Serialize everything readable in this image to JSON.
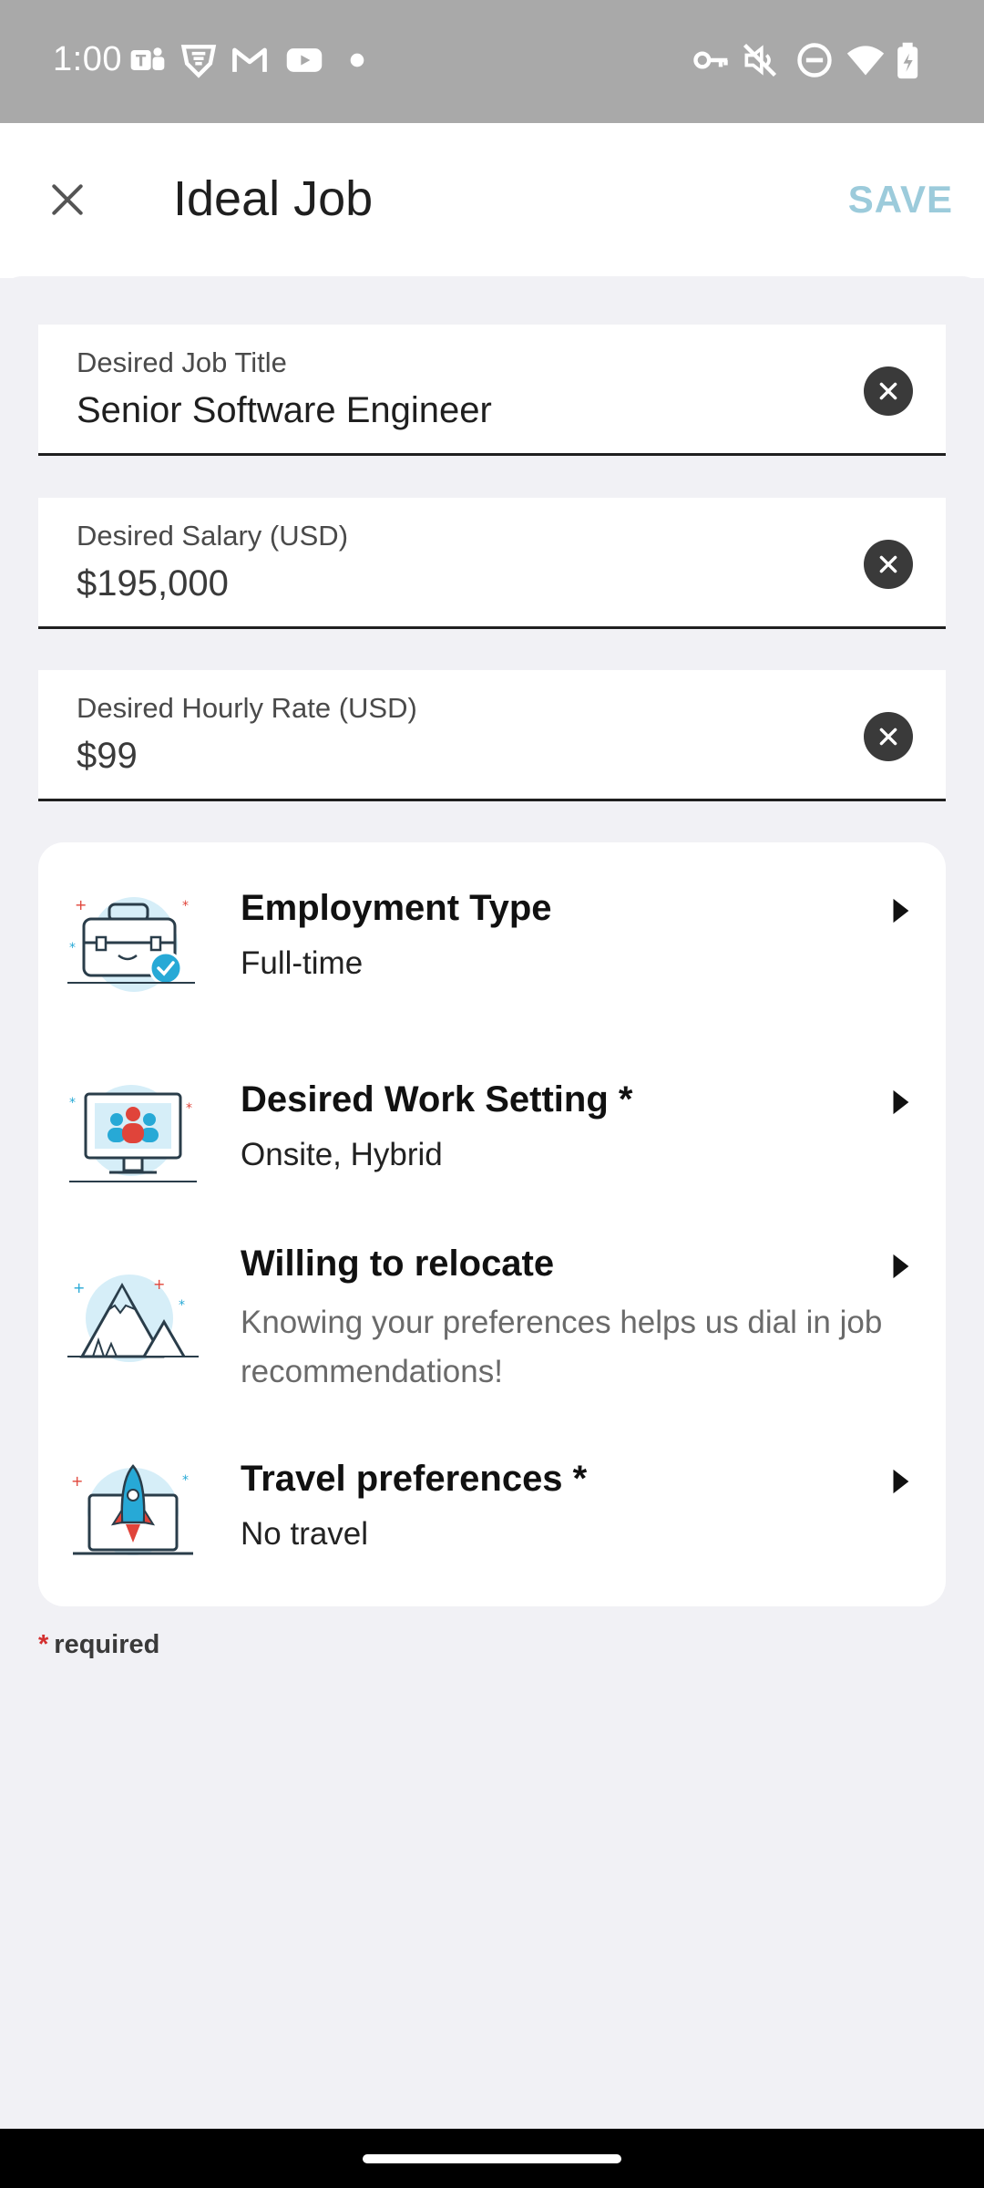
{
  "status_bar": {
    "time": "1:00",
    "icons": [
      "teams-icon",
      "vpn-shield-icon",
      "gmail-icon",
      "youtube-icon",
      "dot-icon",
      "key-icon",
      "mute-icon",
      "dnd-icon",
      "wifi-icon",
      "battery-icon"
    ]
  },
  "app_bar": {
    "title": "Ideal Job",
    "save_label": "SAVE",
    "close_icon": "close-icon"
  },
  "fields": [
    {
      "label": "Desired Job Title",
      "value": "Senior Software Engineer"
    },
    {
      "label": "Desired Salary (USD)",
      "value": "$195,000"
    },
    {
      "label": "Desired Hourly Rate (USD)",
      "value": "$99"
    }
  ],
  "preferences": [
    {
      "title": "Employment Type",
      "subtitle": "Full-time",
      "icon": "briefcase-icon"
    },
    {
      "title": "Desired Work Setting *",
      "subtitle": "Onsite, Hybrid",
      "icon": "monitor-team-icon"
    },
    {
      "title": "Willing to relocate",
      "subtitle": "Knowing your preferences helps us dial in job recommendations!",
      "icon": "mountain-icon"
    },
    {
      "title": "Travel preferences *",
      "subtitle": "No travel",
      "icon": "rocket-laptop-icon"
    }
  ],
  "required_note": {
    "star": "*",
    "text": "required"
  },
  "colors": {
    "accent": "#9ccbdb",
    "required": "#d32f2f",
    "illustration_blue": "#27a9d6",
    "illustration_red": "#e0443a"
  }
}
